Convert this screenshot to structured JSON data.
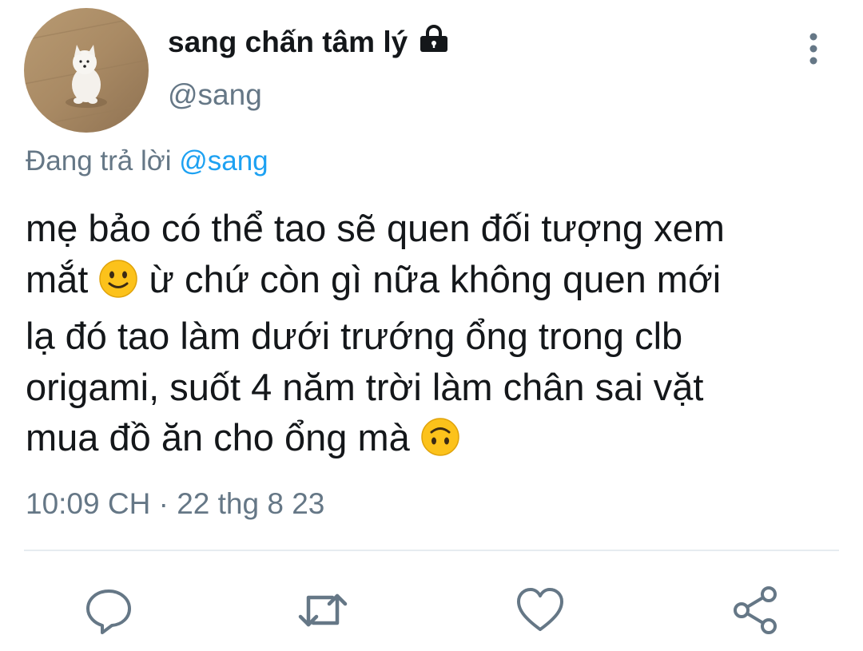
{
  "user": {
    "display_name": "sang chấn tâm lý",
    "handle": "@sang",
    "protected": true
  },
  "reply_context": {
    "prefix": "Đang trả lời",
    "mention": "@sang"
  },
  "tweet": {
    "lines": [
      "mẹ bảo có thể tao sẽ quen đối tượng xem",
      "mắt",
      "ừ chứ còn gì nữa không quen mới",
      "lạ đó tao làm dưới trướng ổng trong clb",
      "origami, suốt 4 năm trời làm chân sai vặt",
      "mua đồ ăn cho ổng mà"
    ],
    "emojis": [
      "slightly-smiling-face",
      "upside-down-face"
    ]
  },
  "meta": {
    "timestamp": "10:09 CH · 22 thg 8 23"
  },
  "actions": [
    "reply-icon",
    "retweet-icon",
    "like-icon",
    "share-icon"
  ],
  "colors": {
    "text": "#14171a",
    "secondary": "#657786",
    "accent": "#1da1f2",
    "divider": "#e6ecf0"
  }
}
